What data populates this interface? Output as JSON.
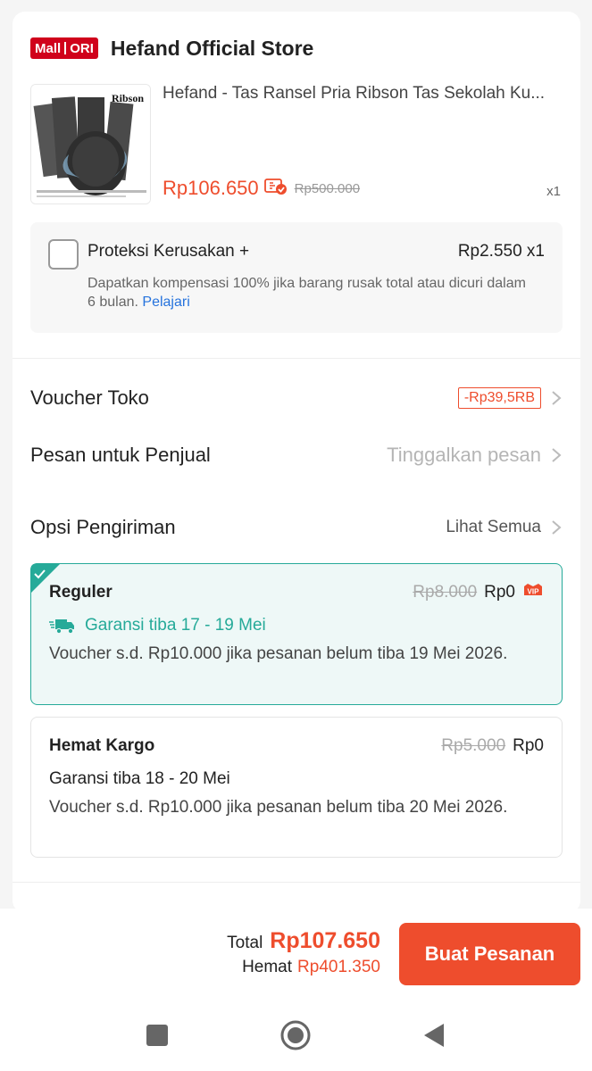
{
  "store": {
    "badge_left": "Mall",
    "badge_right": "ORI",
    "name": "Hefand Official Store"
  },
  "product": {
    "title": "Hefand - Tas Ransel Pria Ribson Tas Sekolah Ku...",
    "image_text": "Ribson",
    "price": "Rp106.650",
    "original_price": "Rp500.000",
    "quantity": "x1"
  },
  "protection": {
    "title": "Proteksi Kerusakan +",
    "price": "Rp2.550 x1",
    "description": "Dapatkan kompensasi 100% jika barang rusak total atau dicuri dalam 6 bulan.",
    "link": "Pelajari",
    "checked": false
  },
  "voucher": {
    "label": "Voucher Toko",
    "value": "-Rp39,5RB"
  },
  "message": {
    "label": "Pesan untuk Penjual",
    "placeholder": "Tinggalkan pesan"
  },
  "shipping": {
    "label": "Opsi Pengiriman",
    "see_all": "Lihat Semua",
    "options": [
      {
        "name": "Reguler",
        "original_price": "Rp8.000",
        "price": "Rp0",
        "badge": "VIP",
        "eta": "Garansi tiba 17 - 19 Mei",
        "desc": "Voucher s.d.  Rp10.000 jika pesanan belum tiba 19 Mei 2026.",
        "selected": true
      },
      {
        "name": "Hemat Kargo",
        "original_price": "Rp5.000",
        "price": "Rp0",
        "eta": "Garansi tiba 18 - 20 Mei",
        "desc": "Voucher s.d.  Rp10.000 jika pesanan belum tiba 20 Mei 2026.",
        "selected": false
      }
    ]
  },
  "footer": {
    "total_label": "Total",
    "total_value": "Rp107.650",
    "save_label": "Hemat",
    "save_value": "Rp401.350",
    "order_button": "Buat Pesanan"
  },
  "colors": {
    "accent": "#ee4d2d",
    "mall_red": "#d0011b",
    "teal": "#26aa99",
    "link": "#2673dd"
  },
  "icons": [
    "chevron-right-icon",
    "coupon-check-icon",
    "truck-icon",
    "checkmark-icon",
    "vip-icon",
    "square-nav-icon",
    "circle-nav-icon",
    "back-triangle-icon"
  ]
}
